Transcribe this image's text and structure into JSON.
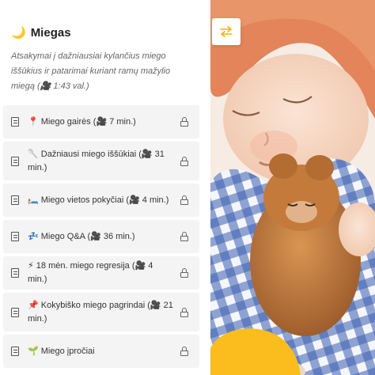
{
  "section": {
    "icon": "🌙",
    "title": "Miegas",
    "subtitle": "Atsakymai į dažniausiai kylančius miego iššūkius ir patarimai kuriant ramų mažylio miegą (🎥 1:43 val.)"
  },
  "lessons": [
    {
      "label": "📍 Miego gairės (🎥 7 min.)",
      "icon": "document-icon",
      "status": "lock-icon"
    },
    {
      "label": "🥄 Dažniausi miego iššūkiai (🎥 31 min.)",
      "icon": "document-icon",
      "status": "lock-icon"
    },
    {
      "label": "🛏️ Miego vietos pokyčiai (🎥 4 min.)",
      "icon": "document-icon",
      "status": "lock-icon"
    },
    {
      "label": "💤 Miego Q&A (🎥 36 min.)",
      "icon": "document-icon",
      "status": "lock-icon"
    },
    {
      "label": "⚡ 18 mėn. miego regresija (🎥 4 min.)",
      "icon": "document-icon",
      "status": "lock-icon"
    },
    {
      "label": "📌 Kokybiško miego pagrindai (🎥 21 min.)",
      "icon": "document-icon",
      "status": "lock-icon"
    },
    {
      "label": "🌱 Miego įpročiai",
      "icon": "document-icon",
      "status": "lock-icon"
    }
  ],
  "swap_button": {
    "icon": "swap-arrows-icon",
    "color": "#f5b400"
  },
  "accent_color": "#fbbd1e"
}
